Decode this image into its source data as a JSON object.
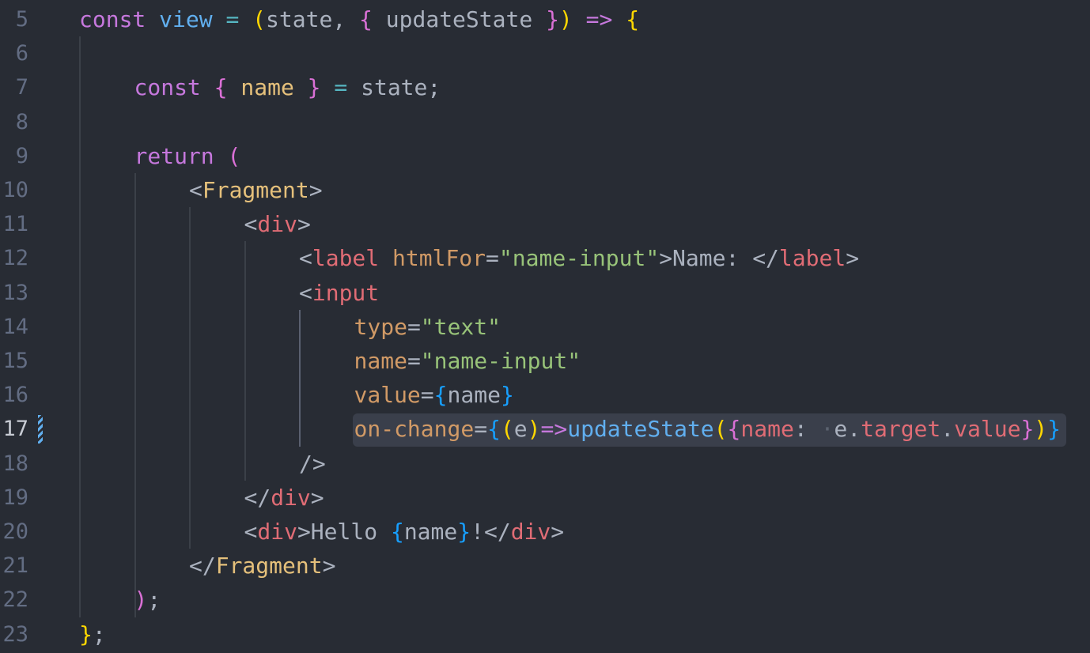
{
  "editor": {
    "language": "javascript-jsx",
    "active_line": 17,
    "colors": {
      "background": "#282c34",
      "keyword": "#c678dd",
      "function": "#61afef",
      "tag": "#e06c75",
      "attribute": "#d19a66",
      "string": "#98c379",
      "bracket_gold": "#ffd700",
      "bracket_orchid": "#da70d6",
      "bracket_blue": "#179fff",
      "git_modified": "#61afef"
    },
    "line_numbers": [
      "5",
      "6",
      "7",
      "8",
      "9",
      "10",
      "11",
      "12",
      "13",
      "14",
      "15",
      "16",
      "17",
      "18",
      "19",
      "20",
      "21",
      "22",
      "23"
    ],
    "lines": [
      [
        [
          "kw",
          "const"
        ],
        [
          "tx",
          " "
        ],
        [
          "fn",
          "view"
        ],
        [
          "tx",
          " "
        ],
        [
          "op",
          "="
        ],
        [
          "tx",
          " "
        ],
        [
          "p1",
          "("
        ],
        [
          "tx",
          "state, "
        ],
        [
          "p2",
          "{"
        ],
        [
          "tx",
          " updateState "
        ],
        [
          "p2",
          "}"
        ],
        [
          "p1",
          ")"
        ],
        [
          "tx",
          " "
        ],
        [
          "kw",
          "=>"
        ],
        [
          "tx",
          " "
        ],
        [
          "p1",
          "{"
        ]
      ],
      [],
      [
        [
          "kw",
          "const"
        ],
        [
          "tx",
          " "
        ],
        [
          "p2",
          "{"
        ],
        [
          "tx",
          " "
        ],
        [
          "vr",
          "name"
        ],
        [
          "tx",
          " "
        ],
        [
          "p2",
          "}"
        ],
        [
          "tx",
          " "
        ],
        [
          "op",
          "="
        ],
        [
          "tx",
          " state;"
        ]
      ],
      [],
      [
        [
          "kw",
          "return"
        ],
        [
          "tx",
          " "
        ],
        [
          "p2",
          "("
        ]
      ],
      [
        [
          "tx",
          "<"
        ],
        [
          "cl",
          "Fragment"
        ],
        [
          "tx",
          ">"
        ]
      ],
      [
        [
          "tx",
          "<"
        ],
        [
          "tg",
          "div"
        ],
        [
          "tx",
          ">"
        ]
      ],
      [
        [
          "tx",
          "<"
        ],
        [
          "tg",
          "label"
        ],
        [
          "tx",
          " "
        ],
        [
          "at",
          "htmlFor"
        ],
        [
          "tx",
          "="
        ],
        [
          "st",
          "\"name-input\""
        ],
        [
          "tx",
          ">Name: </"
        ],
        [
          "tg",
          "label"
        ],
        [
          "tx",
          ">"
        ]
      ],
      [
        [
          "tx",
          "<"
        ],
        [
          "tg",
          "input"
        ]
      ],
      [
        [
          "at",
          "type"
        ],
        [
          "tx",
          "="
        ],
        [
          "st",
          "\"text\""
        ]
      ],
      [
        [
          "at",
          "name"
        ],
        [
          "tx",
          "="
        ],
        [
          "st",
          "\"name-input\""
        ]
      ],
      [
        [
          "at",
          "value"
        ],
        [
          "tx",
          "="
        ],
        [
          "p3",
          "{"
        ],
        [
          "tx",
          "name"
        ],
        [
          "p3",
          "}"
        ]
      ],
      [
        [
          "at",
          "on-change"
        ],
        [
          "tx",
          "="
        ],
        [
          "p3",
          "{"
        ],
        [
          "p1",
          "("
        ],
        [
          "tx",
          "e"
        ],
        [
          "p1",
          ")"
        ],
        [
          "kw",
          "=>"
        ],
        [
          "fn",
          "updateState"
        ],
        [
          "p1",
          "("
        ],
        [
          "p2",
          "{"
        ],
        [
          "pr",
          "name"
        ],
        [
          "tx",
          ":"
        ],
        [
          "ws",
          " ·"
        ],
        [
          "tx",
          "e."
        ],
        [
          "pr",
          "target"
        ],
        [
          "tx",
          "."
        ],
        [
          "pr",
          "value"
        ],
        [
          "p2",
          "}"
        ],
        [
          "p1",
          ")"
        ],
        [
          "p3",
          "}"
        ]
      ],
      [
        [
          "tx",
          "/>"
        ]
      ],
      [
        [
          "tx",
          "</"
        ],
        [
          "tg",
          "div"
        ],
        [
          "tx",
          ">"
        ]
      ],
      [
        [
          "tx",
          "<"
        ],
        [
          "tg",
          "div"
        ],
        [
          "tx",
          ">Hello "
        ],
        [
          "p3",
          "{"
        ],
        [
          "tx",
          "name"
        ],
        [
          "p3",
          "}"
        ],
        [
          "tx",
          "!</"
        ],
        [
          "tg",
          "div"
        ],
        [
          "tx",
          ">"
        ]
      ],
      [
        [
          "tx",
          "</"
        ],
        [
          "cl",
          "Fragment"
        ],
        [
          "tx",
          ">"
        ]
      ],
      [
        [
          "p2",
          ")"
        ],
        [
          "tx",
          ";"
        ]
      ],
      [
        [
          "p1",
          "}"
        ],
        [
          "tx",
          ";"
        ]
      ]
    ]
  }
}
